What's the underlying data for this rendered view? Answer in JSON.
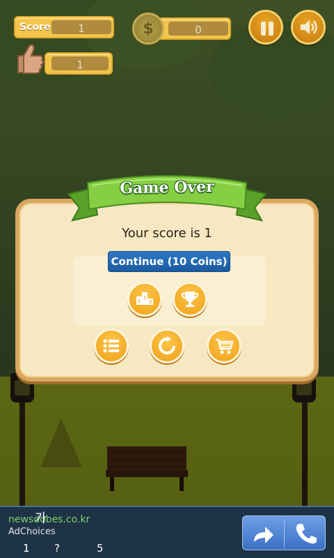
{
  "hud": {
    "score_label": "Score",
    "score_value": "1",
    "likes_value": "1",
    "coins_value": "0",
    "coin_glyph": "$"
  },
  "dialog": {
    "title": "Game Over",
    "score_message": "Your score is 1",
    "continue_label": "Continue (10 Coins)",
    "icons": [
      "leaderboard-icon",
      "trophy-icon",
      "menu-list-icon",
      "restart-icon",
      "shop-cart-icon"
    ]
  },
  "ad": {
    "url": "newsdobes.co.kr",
    "korean_char": "가",
    "ad_choices": "AdChoices",
    "nums": [
      "1",
      "?",
      "5"
    ]
  },
  "colors": {
    "continue_blue": "#1b5aa0",
    "gold": "#f0a019",
    "ribbon_green": "#7cc23a"
  }
}
